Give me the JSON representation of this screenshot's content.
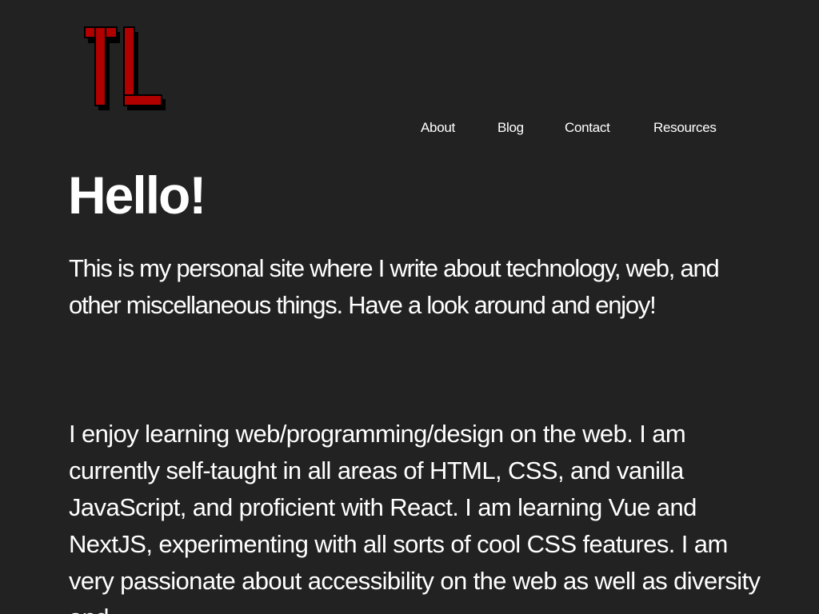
{
  "logo": {
    "text": "TL",
    "colors": {
      "fill": "#b00000",
      "outline": "#000000"
    }
  },
  "nav": {
    "items": [
      {
        "label": "About"
      },
      {
        "label": "Blog"
      },
      {
        "label": "Contact"
      },
      {
        "label": "Resources"
      }
    ]
  },
  "main": {
    "title": "Hello!",
    "intro": "This is my personal site where I write about technology, web, and other miscellaneous things. Have a look around and enjoy!",
    "about": "I enjoy learning web/programming/design on the web. I am currently self-taught in all areas of HTML, CSS, and vanilla JavaScript, and proficient with React. I am learning Vue and NextJS, experimenting with all sorts of cool CSS features. I am very passionate about accessibility on the web as well as diversity and"
  },
  "theme": {
    "background": "#222222",
    "text": "#ffffff"
  }
}
